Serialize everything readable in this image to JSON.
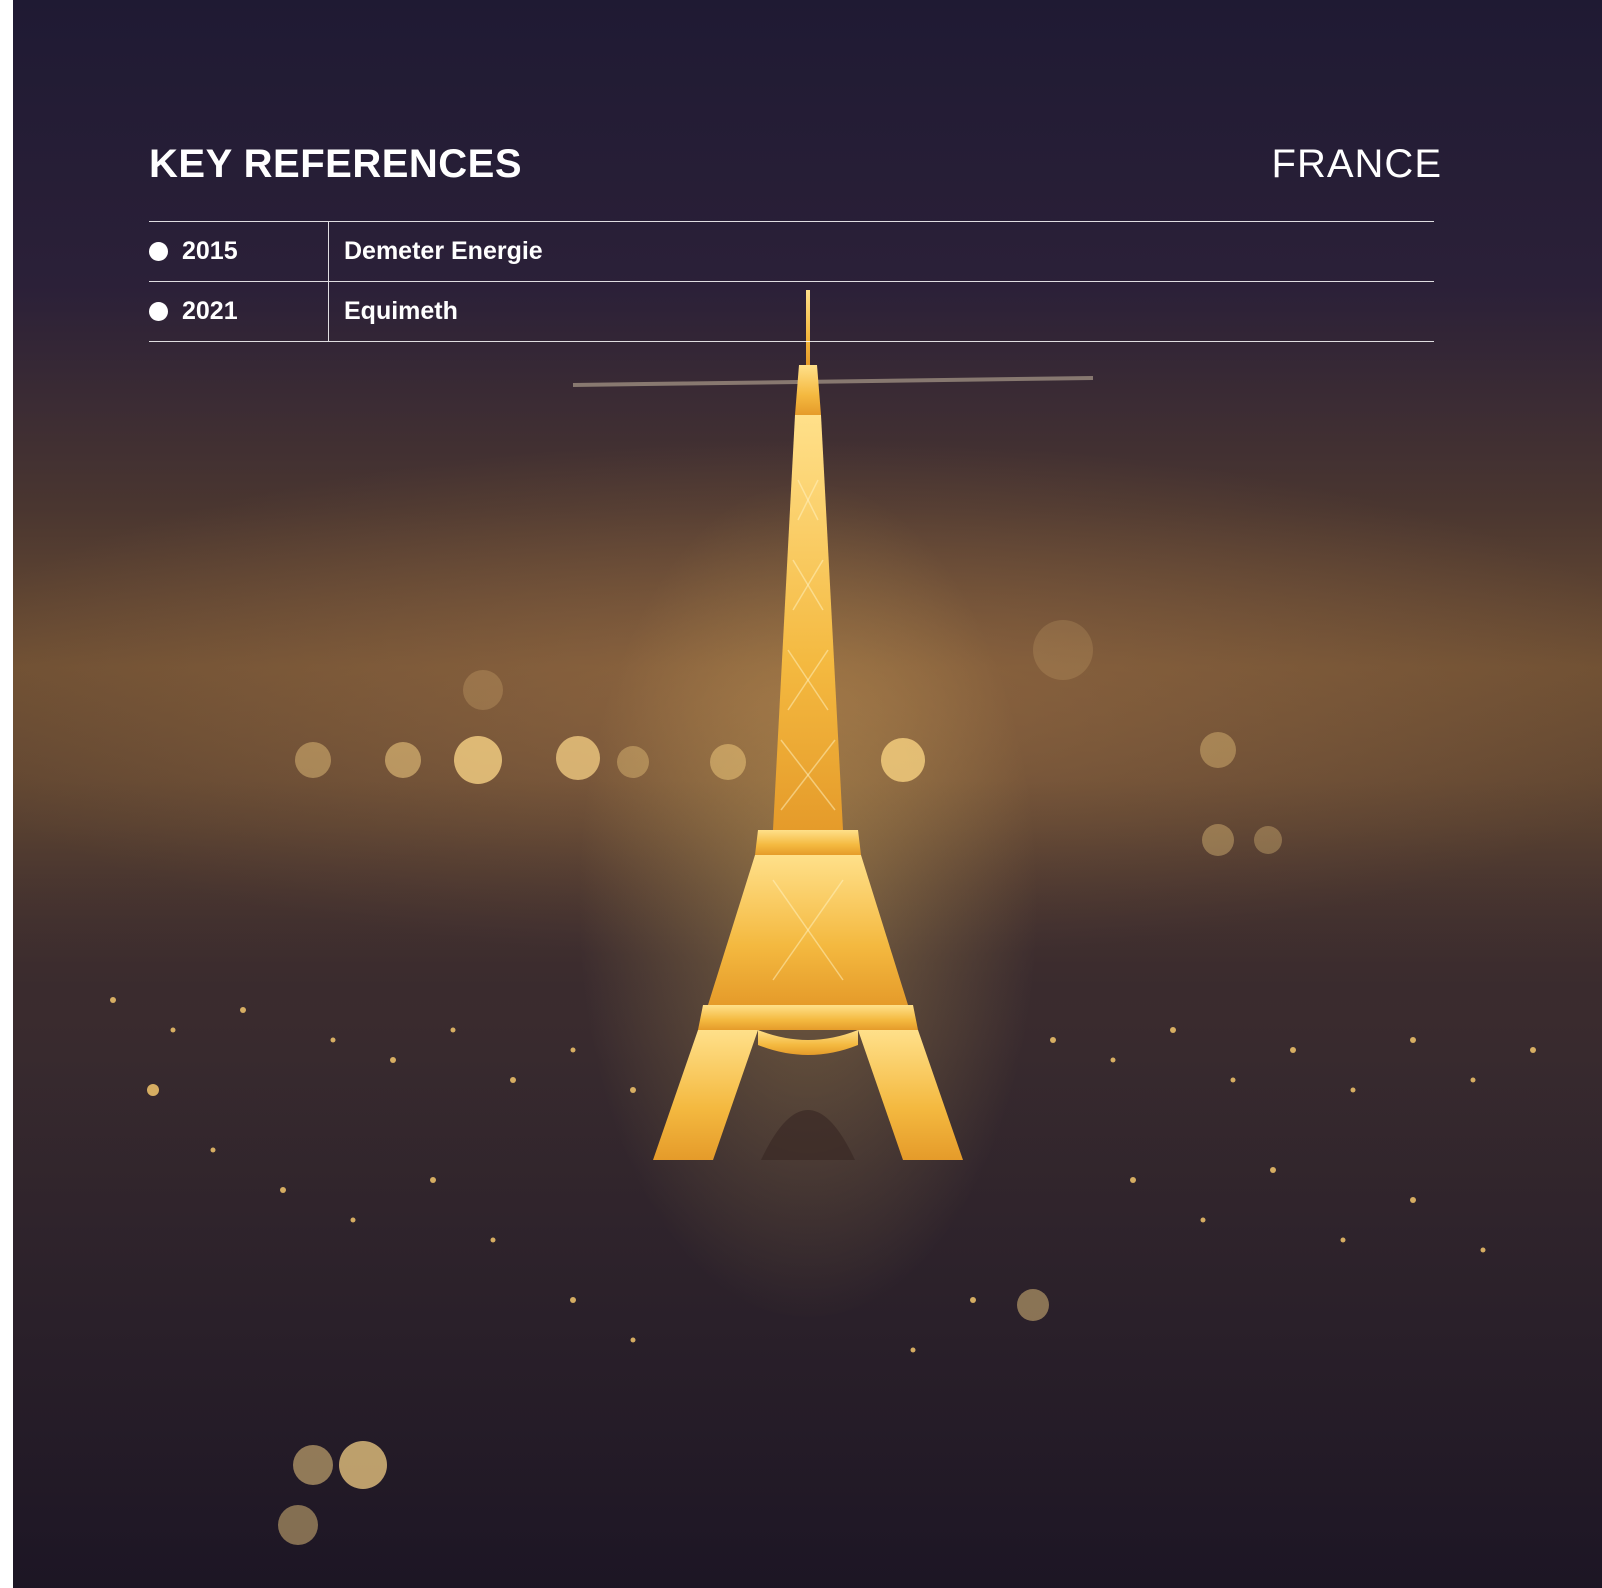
{
  "header": {
    "title": "KEY REFERENCES",
    "country": "FRANCE"
  },
  "references": [
    {
      "year": "2015",
      "name": "Demeter Energie"
    },
    {
      "year": "2021",
      "name": "Equimeth"
    }
  ],
  "colors": {
    "text": "#ffffff",
    "sky_top": "#1f1a33",
    "glow": "#f6c24a"
  }
}
